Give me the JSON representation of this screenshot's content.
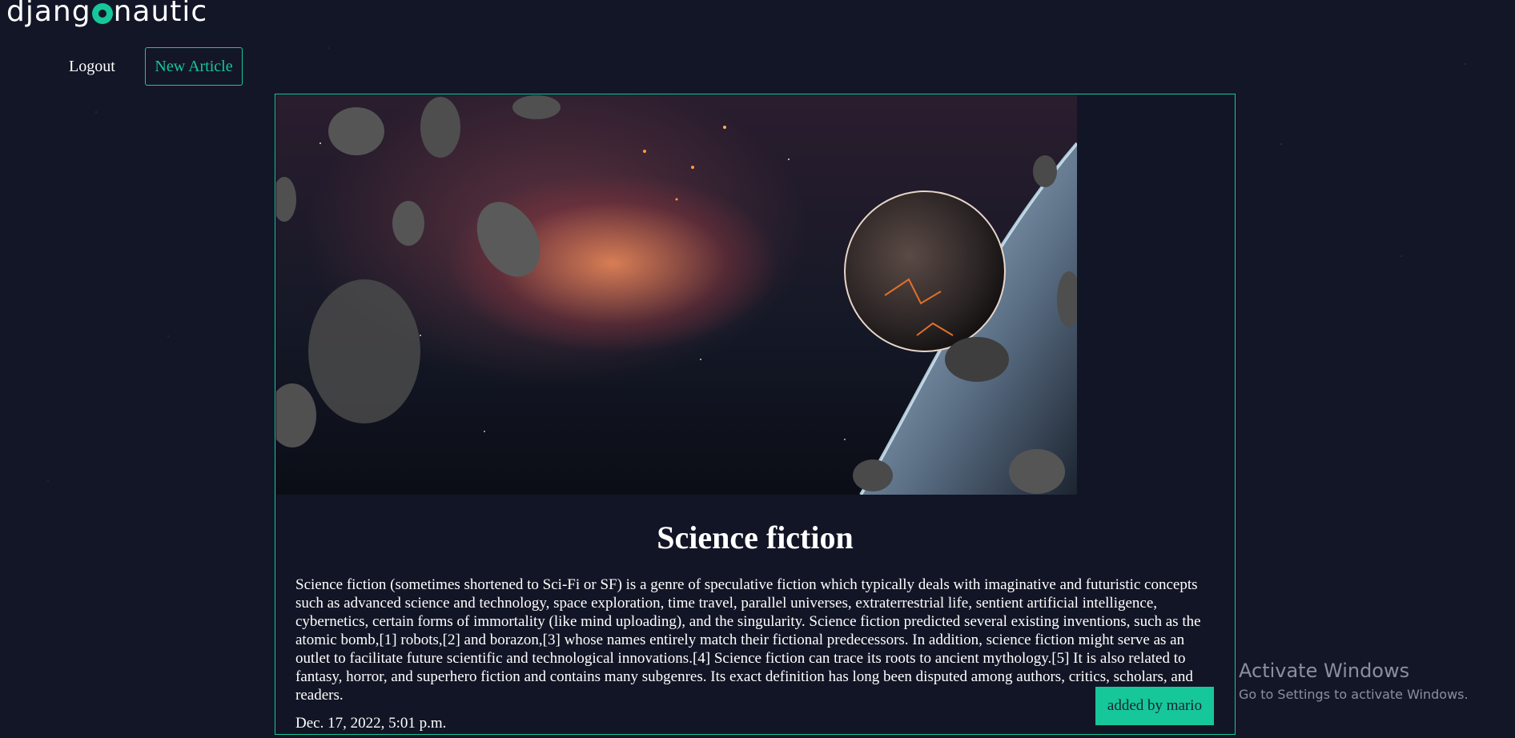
{
  "header": {
    "logo_left": "djang",
    "logo_right": "nautic",
    "logout_label": "Logout",
    "new_article_label": "New Article"
  },
  "article": {
    "title": "Science fiction",
    "body": "Science fiction (sometimes shortened to Sci-Fi or SF) is a genre of speculative fiction which typically deals with imaginative and futuristic concepts such as advanced science and technology, space exploration, time travel, parallel universes, extraterrestrial life, sentient artificial intelligence, cybernetics, certain forms of immortality (like mind uploading), and the singularity. Science fiction predicted several existing inventions, such as the atomic bomb,[1] robots,[2] and borazon,[3] whose names entirely match their fictional predecessors. In addition, science fiction might serve as an outlet to facilitate future scientific and technological innovations.[4] Science fiction can trace its roots to ancient mythology.[5] It is also related to fantasy, horror, and superhero fiction and contains many subgenres. Its exact definition has long been disputed among authors, critics, scholars, and readers.",
    "date": "Dec. 17, 2022, 5:01 p.m.",
    "author_badge": "added by mario"
  },
  "watermark": {
    "title": "Activate Windows",
    "subtitle": "Go to Settings to activate Windows."
  },
  "colors": {
    "accent": "#16c79a",
    "background": "#131627",
    "card": "#121525"
  }
}
